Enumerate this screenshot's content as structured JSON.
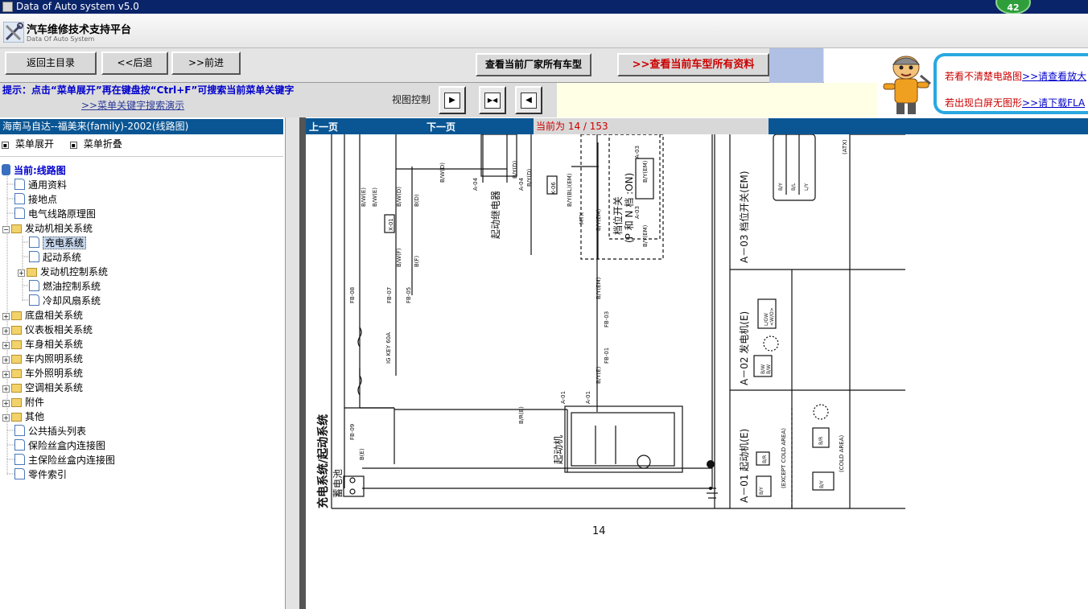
{
  "window": {
    "title": "Data of Auto system v5.0",
    "badge": "42"
  },
  "header": {
    "title": "汽车维修技术支持平台",
    "subtitle": "Data Of Auto System"
  },
  "toolbar": {
    "back_main": "返回主目录",
    "back": "<<后退",
    "forward": ">>前进",
    "maker_models": "查看当前厂家所有车型",
    "all_data": ">>查看当前车型所有资料"
  },
  "hint": {
    "text": "提示：点击“菜单展开”再在键盘按“Ctrl+F”可搜索当前菜单关键字",
    "demo_link": ">>菜单关键字搜索演示",
    "view_control": "视图控制"
  },
  "ad": {
    "line1_red": "若看不清楚电路图",
    "line1_link": ">>请查看放大",
    "line2_red": "若出现白屏无图形",
    "line2_link": ">>请下载FLA"
  },
  "sidebar": {
    "title": "海南马自达--福美来(family)-2002(线路图)",
    "expand": "菜单展开",
    "collapse": "菜单折叠",
    "root": "当前:线路图",
    "items": [
      "通用资料",
      "接地点",
      "电气线路原理图",
      "发动机相关系统",
      "充电系统",
      "起动系统",
      "发动机控制系统",
      "燃油控制系统",
      "冷却风扇系统",
      "底盘相关系统",
      "仪表板相关系统",
      "车身相关系统",
      "车内照明系统",
      "车外照明系统",
      "空调相关系统",
      "附件",
      "其他",
      "公共插头列表",
      "保险丝盒内连接图",
      "主保险丝盒内连接图",
      "零件索引"
    ]
  },
  "nav": {
    "prev": "上一页",
    "next": "下一页",
    "page": "当前为  14 / 153"
  },
  "diagram": {
    "title": "充电系统/起动系统",
    "page_number": "14",
    "labels": {
      "battery": "蓄电池",
      "starter": "起动机",
      "relay": "起动继电器",
      "switch_pn": "(P 和 N 档 :ON)",
      "switch": "档位开关",
      "a01": "A－01 起动机(E)",
      "a02": "A－02 发电机(E)",
      "a03": "A－03 档位开关(EM)",
      "except_cold": "(EXCEPT COLD AREA)",
      "cold": "(COLD AREA)",
      "ig_key": "IG KEY 60A",
      "mtx": "MTX",
      "atx": "(ATX)",
      "wires": [
        "B/W(E)",
        "B/W(E)",
        "B/W(D)",
        "B(D)",
        "B/W(D)",
        "B/Y(D)",
        "B/Y(D)",
        "B/Y(EM)",
        "B/Y(EM)",
        "B/Y(EM)",
        "B/Y(E)",
        "B/R(E)",
        "B(E)",
        "B/W(F)",
        "B(F)",
        "B/Y(BL)(EM)",
        "B/Y(EM)"
      ],
      "connectors": [
        "FB-08",
        "FB-07",
        "FB-05",
        "FB-09",
        "FB-01",
        "FB-03",
        "X-01",
        "X-06",
        "A-04",
        "A-04",
        "A-03",
        "A-03",
        "A-01",
        "A-01"
      ],
      "terminals": [
        "A",
        "B",
        "C",
        "D",
        "F",
        "E",
        "E"
      ],
      "a02_pins": [
        "2A",
        "2B",
        "1A",
        "1B",
        "B/W",
        "B/W",
        "L/GW",
        "<W/O>",
        "W/L",
        "<Y/B>"
      ],
      "a01_pins": [
        "B/Y",
        "B/R",
        "B/Y",
        "B/R"
      ],
      "a03_pins": [
        "B/Y",
        "Y",
        "(G/YR)",
        "L/GR",
        "B/L",
        "L/Y",
        "B/Y"
      ]
    }
  }
}
